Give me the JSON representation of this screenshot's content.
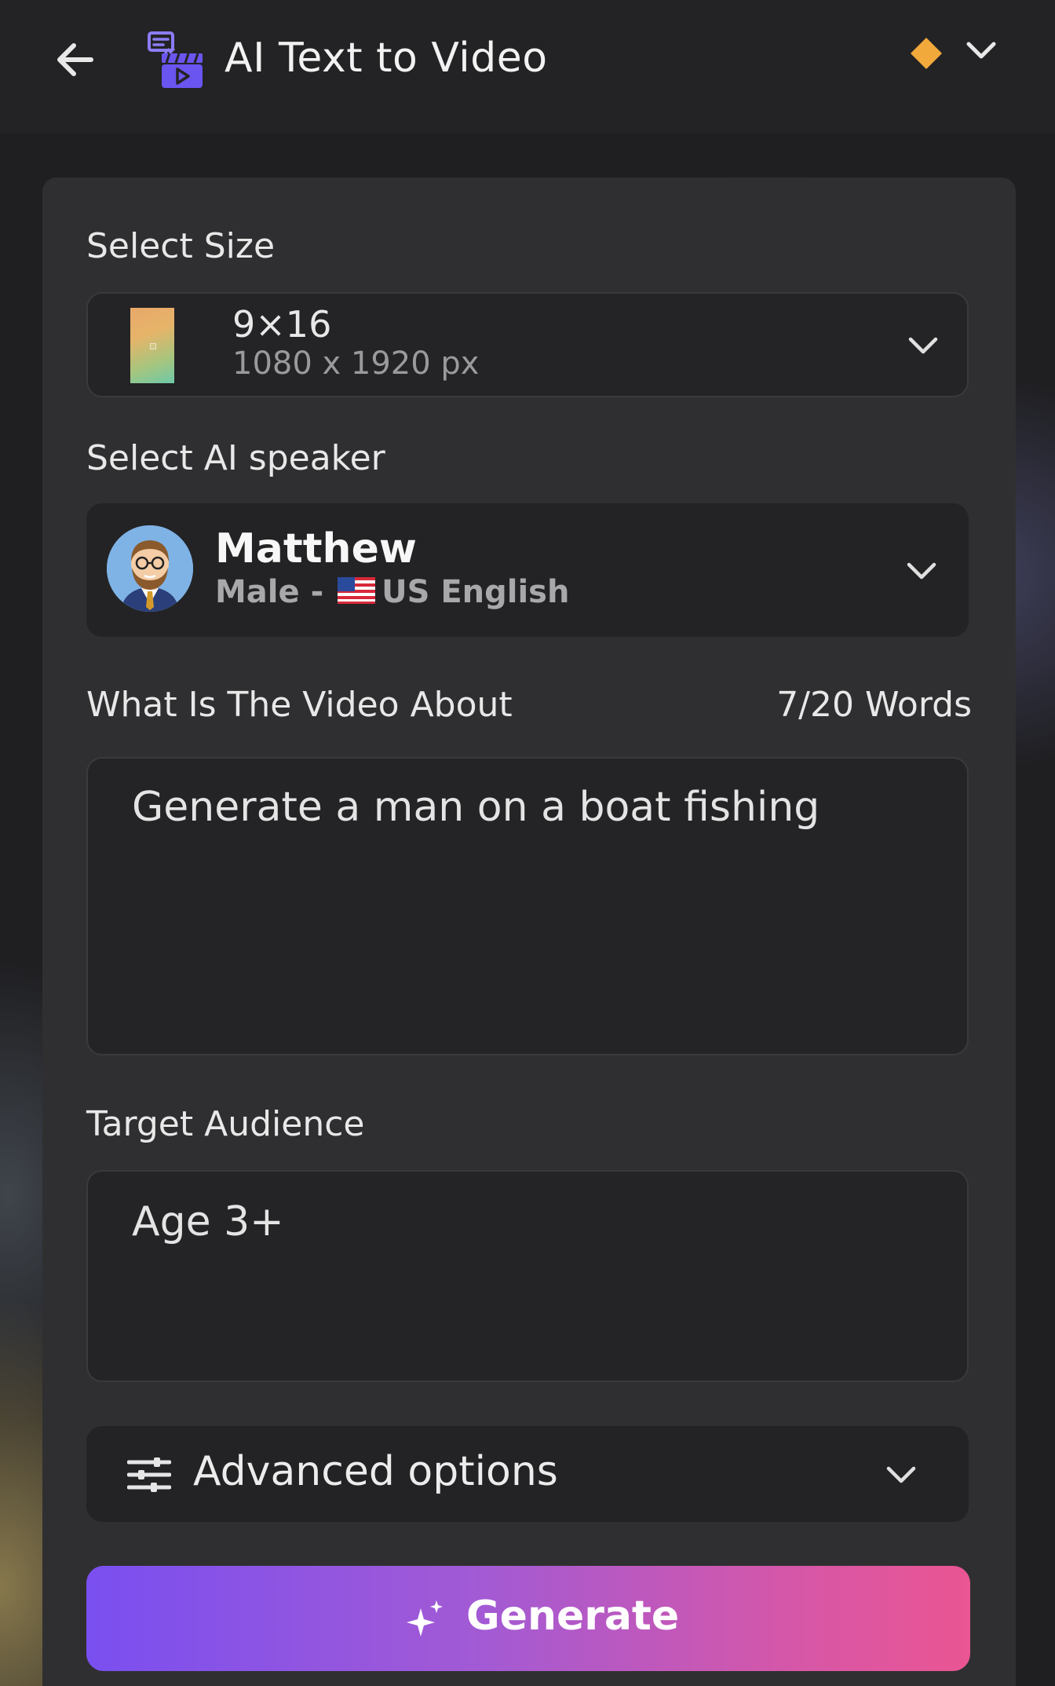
{
  "header": {
    "title": "AI Text to Video",
    "back_icon": "arrow-left-icon",
    "app_icon": "text-to-video-icon",
    "premium_icon": "diamond-icon",
    "menu_icon": "chevron-down-icon",
    "premium_color": "#f2a93b"
  },
  "size": {
    "label": "Select Size",
    "value": "9×16",
    "dimensions": "1080 x 1920 px"
  },
  "speaker": {
    "label": "Select AI speaker",
    "name": "Matthew",
    "gender": "Male -",
    "language": "US English"
  },
  "about": {
    "label": "What Is The Video About",
    "word_count": "7/20 Words",
    "value": "Generate a man on a boat fishing"
  },
  "audience": {
    "label": "Target Audience",
    "value": "Age 3+"
  },
  "advanced": {
    "label": "Advanced options"
  },
  "generate": {
    "label": "Generate",
    "gradient_start": "#7a4ff0",
    "gradient_end": "#ea5592"
  }
}
